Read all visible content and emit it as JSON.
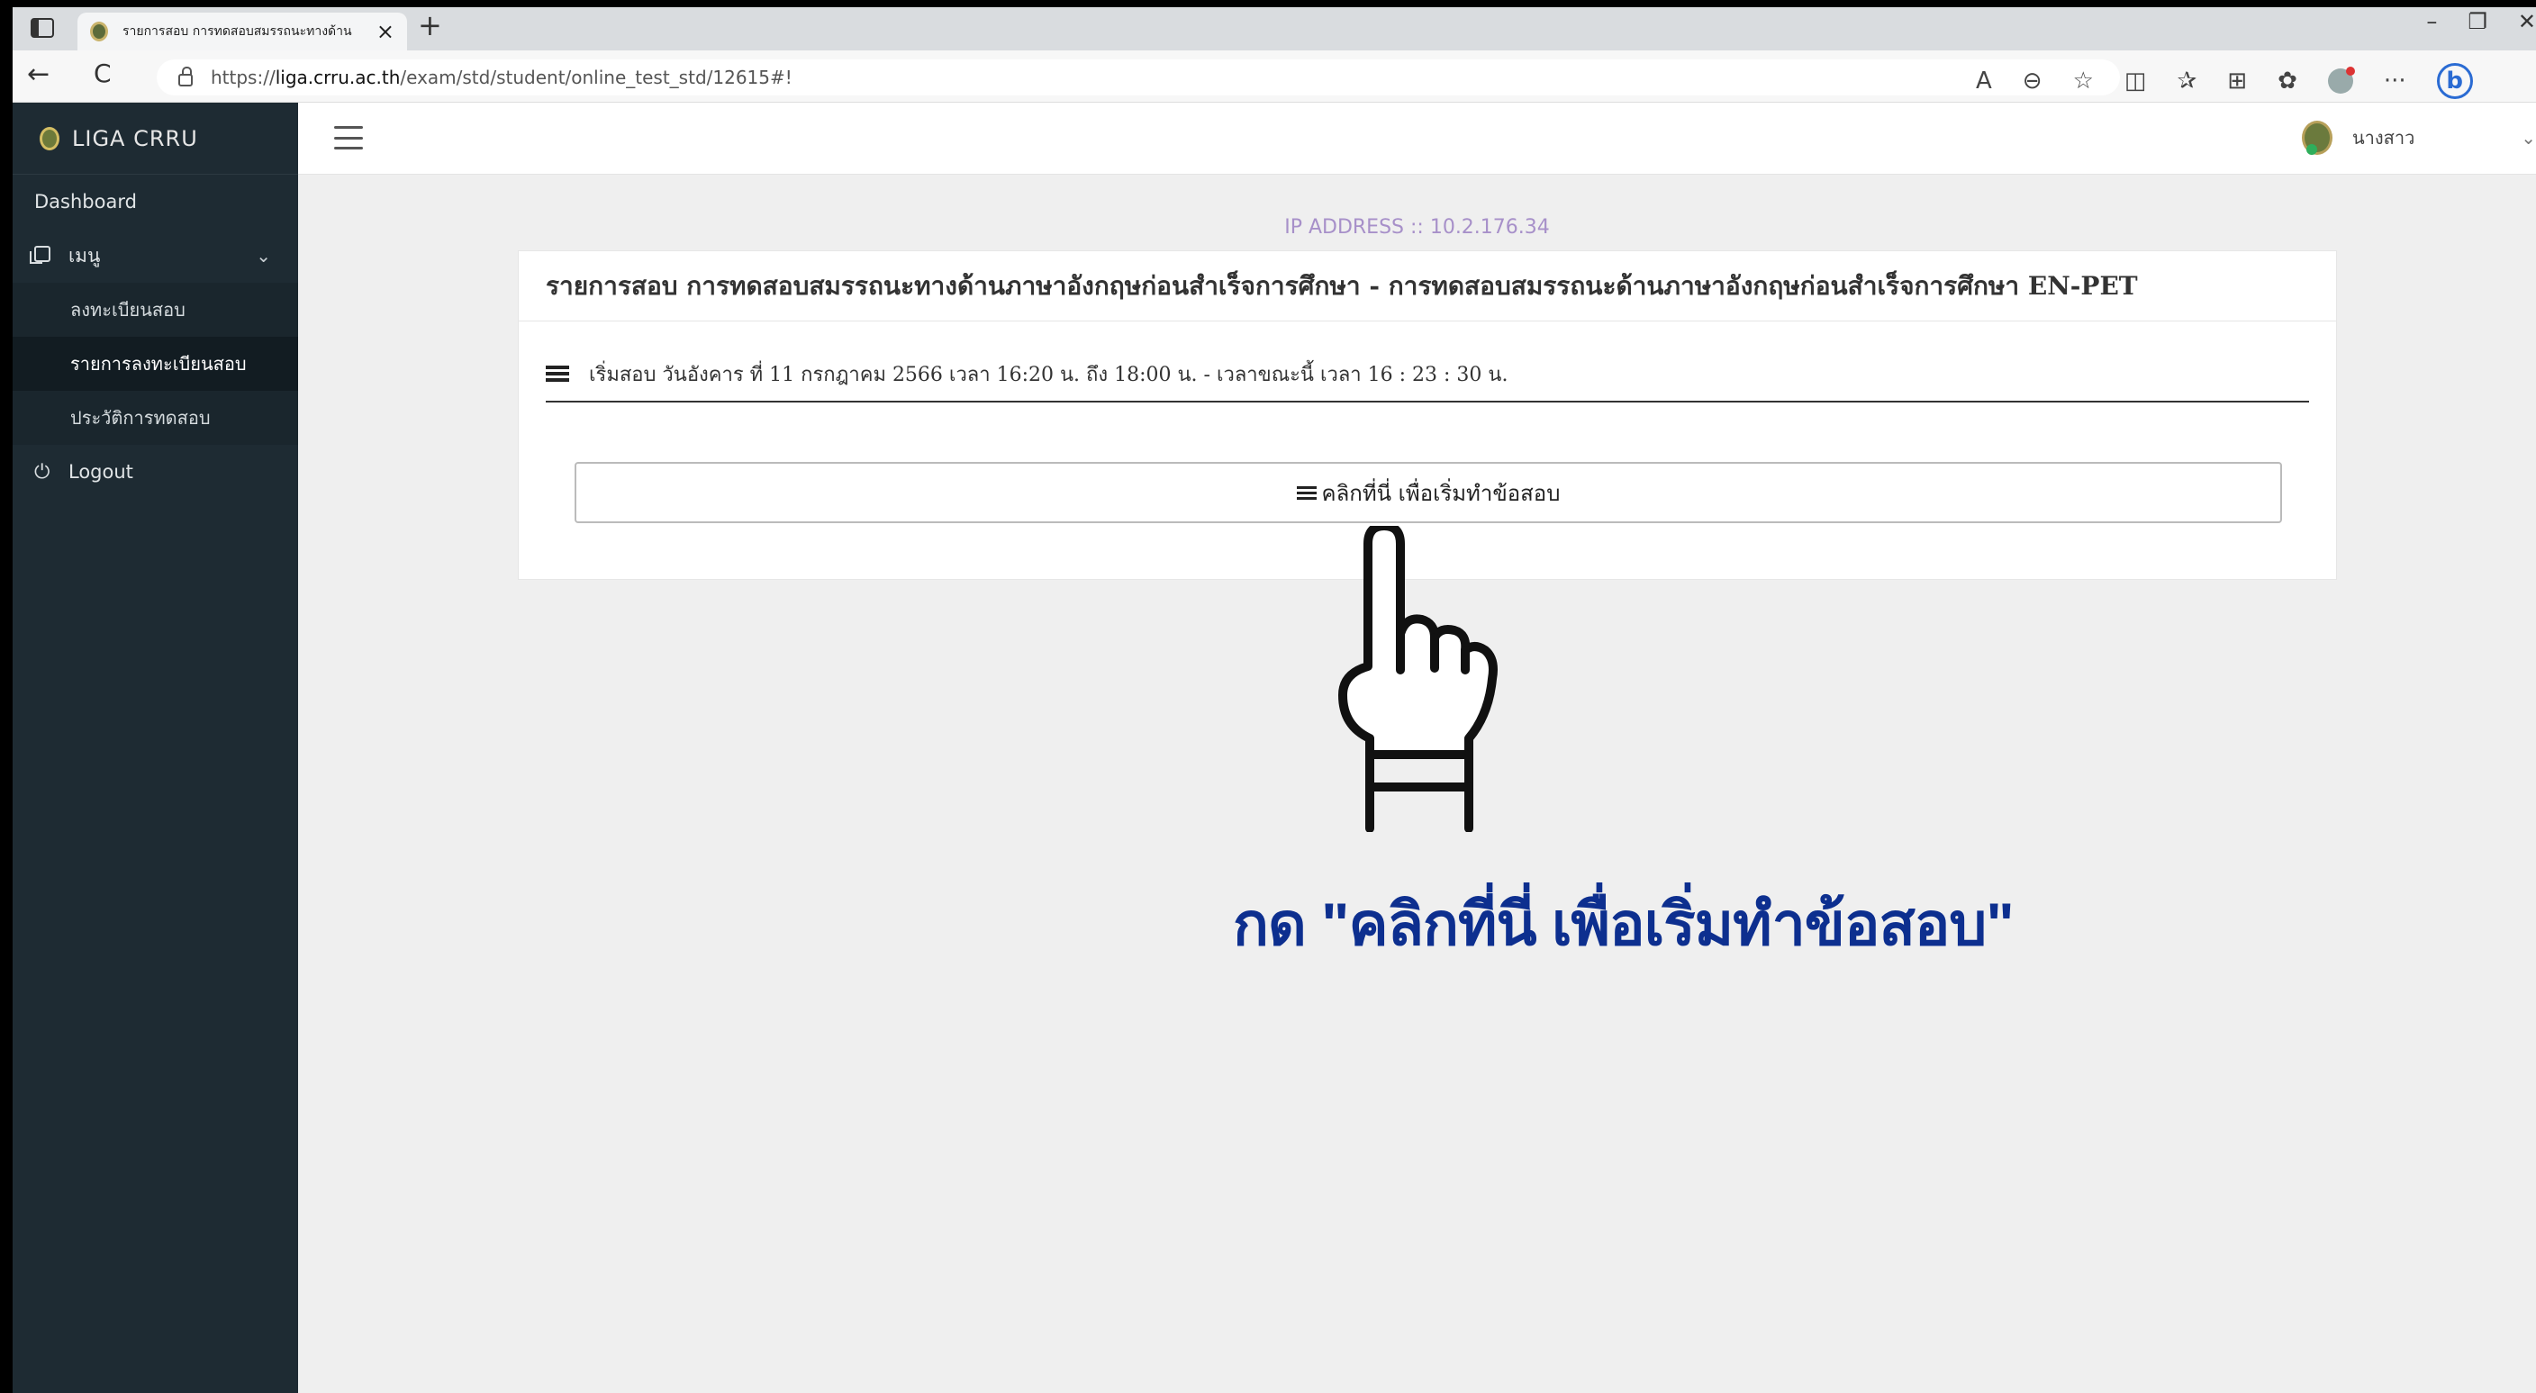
{
  "browser": {
    "tab_title": "รายการสอบ การทดสอบสมรรถนะทางด้าน",
    "tab_close": "×",
    "new_tab": "+",
    "url_prefix": "https://",
    "url_host": "liga.crru.ac.th",
    "url_path": "/exam/std/student/online_test_std/12615#!",
    "back": "←",
    "reload": "C",
    "window_minimize": "–",
    "window_restore": "❐",
    "window_close": "✕",
    "toolbar": {
      "read_aloud": "A",
      "zoom": "⊖",
      "favorite": "☆",
      "split": "◫",
      "favorites": "✰",
      "collections": "⊞",
      "extensions": "✿",
      "more": "···",
      "bing": "b"
    }
  },
  "sidebar": {
    "brand": "LIGA CRRU",
    "dashboard": "Dashboard",
    "menu_label": "เมนู",
    "menu_chevron": "⌄",
    "sub_items": [
      {
        "label": "ลงทะเบียนสอบ"
      },
      {
        "label": "รายการลงทะเบียนสอบ"
      },
      {
        "label": "ประวัติการทดสอบ"
      }
    ],
    "logout": "Logout",
    "logout_icon": "⏻"
  },
  "topbar": {
    "user_name": "นางสาว",
    "user_chevron": "⌄"
  },
  "main": {
    "ip_address": "IP ADDRESS :: 10.2.176.34",
    "card_title": "รายการสอบ การทดสอบสมรรถนะทางด้านภาษาอังกฤษก่อนสำเร็จการศึกษา - การทดสอบสมรรถนะด้านภาษาอังกฤษก่อนสำเร็จการศึกษา EN-PET",
    "exam_time": "เริ่มสอบ วันอังคาร ที่ 11 กรกฎาคม 2566 เวลา 16:20 น. ถึง 18:00 น. - เวลาขณะนี้ เวลา 16 : 23 : 30 น.",
    "start_button": "คลิกที่นี่ เพื่อเริ่มทำข้อสอบ"
  },
  "annotation": {
    "instruction": "กด \"คลิกที่นี่ เพื่อเริ่มทำข้อสอบ\"",
    "pointer_icon": "hand-pointer-icon"
  },
  "colors": {
    "sidebar_bg": "#1e2b33",
    "ip_text": "#a790c9",
    "instruction_text": "#0d2f8f"
  }
}
